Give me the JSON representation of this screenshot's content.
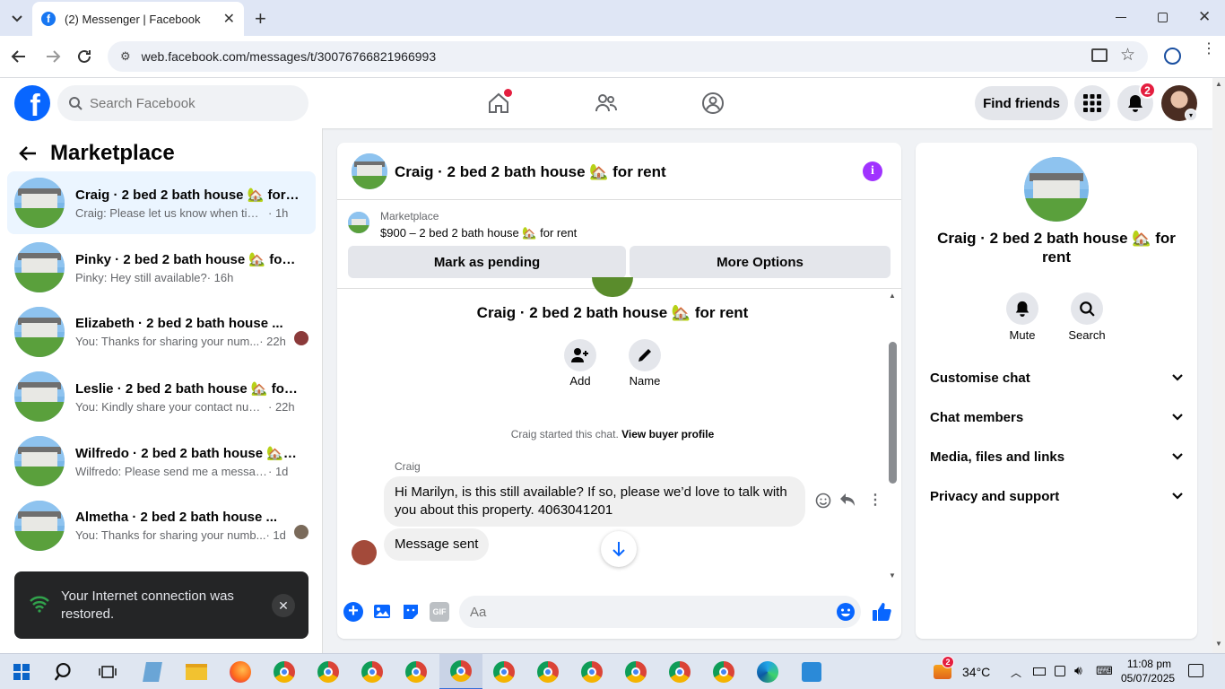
{
  "browser": {
    "tab_title": "(2) Messenger | Facebook",
    "url": "web.facebook.com/messages/t/30076766821966993"
  },
  "header": {
    "search_placeholder": "Search Facebook",
    "find_friends": "Find friends",
    "notification_count": "2"
  },
  "left": {
    "title": "Marketplace",
    "conversations": [
      {
        "name": "Craig · 2 bed 2 bath house 🏡 for r...",
        "snippet": "Craig: Please let us know when time p...",
        "time": "· 1h",
        "active": true
      },
      {
        "name": "Pinky · 2 bed 2 bath house 🏡 for r...",
        "snippet": "Pinky: Hey still available?",
        "time": "· 16h"
      },
      {
        "name": "Elizabeth · 2 bed 2 bath house ...",
        "snippet": "You: Thanks for sharing your num...",
        "time": "· 22h"
      },
      {
        "name": "Leslie · 2 bed 2 bath house 🏡 for ...",
        "snippet": "You: Kindly share your contact numb...",
        "time": "· 22h"
      },
      {
        "name": "Wilfredo · 2 bed 2 bath house 🏡 f...",
        "snippet": "Wilfredo: Please send me a message. I...",
        "time": "· 1d"
      },
      {
        "name": "Almetha · 2 bed 2 bath house ...",
        "snippet": "You: Thanks for sharing your numb...",
        "time": "· 1d"
      }
    ]
  },
  "toast": {
    "message": "Your Internet connection was restored."
  },
  "chat": {
    "title": "Craig · 2 bed 2 bath house 🏡 for rent",
    "marketplace_label": "Marketplace",
    "listing": "$900 – 2 bed 2 bath house 🏡 for rent",
    "mark_pending": "Mark as pending",
    "more_options": "More Options",
    "center_name": "Craig · 2 bed 2 bath house 🏡 for rent",
    "add_label": "Add",
    "name_label": "Name",
    "started_text": "Craig started this chat.",
    "view_profile": "View buyer profile",
    "sender": "Craig",
    "message1": "Hi Marilyn, is this still available?  If so, please we’d love to talk with you about this property.  4063041201",
    "message2": "Message sent",
    "input_placeholder": "Aa"
  },
  "right": {
    "name": "Craig · 2 bed 2 bath house 🏡 for rent",
    "mute": "Mute",
    "search": "Search",
    "sections": [
      "Customise chat",
      "Chat members",
      "Media, files and links",
      "Privacy and support"
    ]
  },
  "taskbar": {
    "temperature": "34°C",
    "time": "11:08 pm",
    "date": "05/07/2025",
    "weather_badge": "2"
  },
  "colors": {
    "fb_blue": "#0866ff",
    "accent_purple": "#a033ff",
    "toast_bg": "#242526"
  }
}
